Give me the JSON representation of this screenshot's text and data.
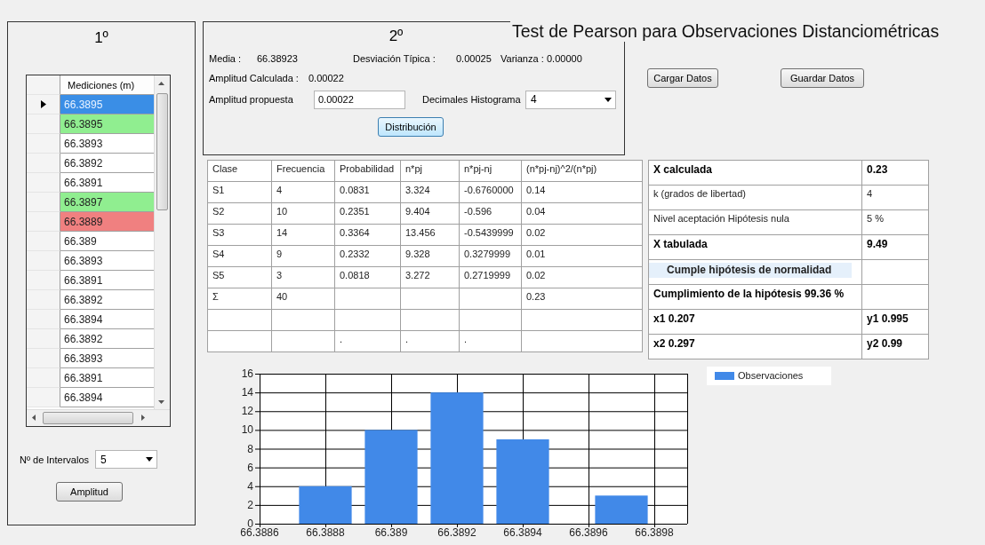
{
  "title": "Test de Pearson para Observaciones Distanciométricas",
  "panel_1": {
    "heading": "1º",
    "grid": {
      "column": "Mediciones (m)",
      "rows": [
        {
          "value": "66.3895",
          "selected": true
        },
        {
          "value": "66.3895",
          "selected": false,
          "color": "#90ee90"
        },
        {
          "value": "66.3893",
          "selected": false,
          "color": "#ffffff"
        },
        {
          "value": "66.3892",
          "selected": false,
          "color": "#ffffff"
        },
        {
          "value": "66.3891",
          "selected": false,
          "color": "#ffffff"
        },
        {
          "value": "66.3897",
          "selected": false,
          "color": "#90ee90"
        },
        {
          "value": "66.3889",
          "selected": false,
          "color": "#f08080"
        },
        {
          "value": "66.389",
          "selected": false,
          "color": "#ffffff"
        },
        {
          "value": "66.3893",
          "selected": false,
          "color": "#ffffff"
        },
        {
          "value": "66.3891",
          "selected": false,
          "color": "#ffffff"
        },
        {
          "value": "66.3892",
          "selected": false,
          "color": "#ffffff"
        },
        {
          "value": "66.3894",
          "selected": false,
          "color": "#ffffff"
        },
        {
          "value": "66.3892",
          "selected": false,
          "color": "#ffffff"
        },
        {
          "value": "66.3893",
          "selected": false,
          "color": "#ffffff"
        },
        {
          "value": "66.3891",
          "selected": false,
          "color": "#ffffff"
        },
        {
          "value": "66.3894",
          "selected": false,
          "color": "#ffffff"
        }
      ]
    },
    "intervals": {
      "label": "Nº de Intervalos",
      "value": "5"
    },
    "button": "Amplitud"
  },
  "panel_2": {
    "heading": "2º",
    "stats": [
      {
        "label": "Media :",
        "value": "66.38923"
      },
      {
        "label": "Desviación Típica :",
        "value": "0.00025"
      },
      {
        "label": "Varianza :",
        "value": "0.00000"
      },
      {
        "label": "Amplitud Calculada :",
        "value": "0.00022"
      }
    ],
    "proposed": {
      "label": "Amplitud propuesta",
      "value": "0.00022"
    },
    "decimals": {
      "label": "Decimales Histograma",
      "value": "4"
    },
    "button": "Distribución"
  },
  "buttons": [
    "Cargar Datos",
    "Guardar Datos"
  ],
  "frequency_table": {
    "columns": [
      "Clase",
      "Frecuencia",
      "Probabilidad",
      "n*pj",
      "n*pj-nj",
      "(n*pj-nj)^2/(n*pj)"
    ],
    "rows": [
      {
        "clase": "S1",
        "frecuencia": "4",
        "probabilidad": "0.0831",
        "n_pj": "3.324",
        "n_pj_nj": "-0.6760000",
        "chi_term": "0.14"
      },
      {
        "clase": "S2",
        "frecuencia": "10",
        "probabilidad": "0.2351",
        "n_pj": "9.404",
        "n_pj_nj": "-0.596",
        "chi_term": "0.04"
      },
      {
        "clase": "S3",
        "frecuencia": "14",
        "probabilidad": "0.3364",
        "n_pj": "13.456",
        "n_pj_nj": "-0.5439999",
        "chi_term": "0.02"
      },
      {
        "clase": "S4",
        "frecuencia": "9",
        "probabilidad": "0.2332",
        "n_pj": "9.328",
        "n_pj_nj": "0.3279999",
        "chi_term": "0.01"
      },
      {
        "clase": "S5",
        "frecuencia": "3",
        "probabilidad": "0.0818",
        "n_pj": "3.272",
        "n_pj_nj": "0.2719999",
        "chi_term": "0.02"
      },
      {
        "clase": "Σ",
        "frecuencia": "40",
        "chi_term": "0.23"
      },
      {},
      {
        "probabilidad": ".",
        "n_pj": ".",
        "n_pj_nj": "."
      }
    ]
  },
  "results": [
    {
      "kind": "result",
      "label": "X calculada",
      "value": "0.23"
    },
    {
      "kind": "parameter",
      "label": "k (grados de libertad)",
      "value": "4"
    },
    {
      "kind": "parameter",
      "label": "Nivel aceptación Hipótesis nula",
      "value": "5 %"
    },
    {
      "kind": "result",
      "label": "X tabulada",
      "value": "9.49"
    },
    {
      "kind": "verdict",
      "label": "Cumple hipótesis de normalidad"
    },
    {
      "kind": "result",
      "label": "Cumplimiento de la hipótesis 99.36 %"
    },
    {
      "kind": "result",
      "label": "x1 0.207",
      "value": "y1 0.995"
    },
    {
      "kind": "result",
      "label": "x2 0.297",
      "value": "y2 0.99"
    }
  ],
  "histogram": {
    "chart_data": {
      "type": "bar",
      "x": [
        66.3888,
        66.389,
        66.3892,
        66.3894,
        66.3897
      ],
      "series": [
        {
          "name": "Observaciones",
          "color": "#4189e8",
          "values": [
            4,
            10,
            14,
            9,
            3
          ]
        }
      ],
      "xlim": [
        66.3886,
        66.3899
      ],
      "ylim": [
        0,
        16
      ],
      "xticks": [
        66.3886,
        66.3888,
        66.389,
        66.3892,
        66.3894,
        66.3896,
        66.3898
      ],
      "yticks": [
        0,
        2,
        4,
        6,
        8,
        10,
        12,
        14,
        16
      ],
      "grid": true
    }
  }
}
